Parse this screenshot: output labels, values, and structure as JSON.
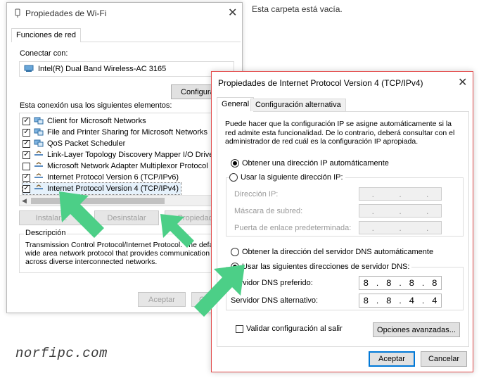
{
  "background": {
    "empty_folder_text": "Esta carpeta está vacía."
  },
  "wifi_dialog": {
    "title": "Propiedades de Wi-Fi",
    "tab": "Funciones de red",
    "connect_using_label": "Conectar con:",
    "adapter": "Intel(R) Dual Band Wireless-AC 3165",
    "configure_button": "Configurar...",
    "items_label": "Esta conexión usa los siguientes elementos:",
    "items": [
      {
        "label": "Client for Microsoft Networks",
        "checked": true,
        "icon": "network-client-icon"
      },
      {
        "label": "File and Printer Sharing for Microsoft Networks",
        "checked": true,
        "icon": "file-sharing-icon"
      },
      {
        "label": "QoS Packet Scheduler",
        "checked": true,
        "icon": "scheduler-icon"
      },
      {
        "label": "Link-Layer Topology Discovery Mapper I/O Driver",
        "checked": true,
        "icon": "protocol-icon"
      },
      {
        "label": "Microsoft Network Adapter Multiplexor Protocol",
        "checked": false,
        "icon": "protocol-icon"
      },
      {
        "label": "Internet Protocol Version 6 (TCP/IPv6)",
        "checked": true,
        "icon": "protocol-icon"
      },
      {
        "label": "Internet Protocol Version 4 (TCP/IPv4)",
        "checked": true,
        "icon": "protocol-icon"
      }
    ],
    "install_button": "Instalar...",
    "uninstall_button": "Desinstalar",
    "properties_button": "Propiedades",
    "description_label": "Descripción",
    "description_text": "Transmission Control Protocol/Internet Protocol. The default wide area network protocol that provides communication across diverse interconnected networks.",
    "ok_button": "Aceptar",
    "cancel_button": "Cancelar"
  },
  "ipv4_dialog": {
    "title": "Propiedades de Internet Protocol Version 4 (TCP/IPv4)",
    "tabs": [
      "General",
      "Configuración alternativa"
    ],
    "intro_text": "Puede hacer que la configuración IP se asigne automáticamente si la red admite esta funcionalidad. De lo contrario, deberá consultar con el administrador de red cuál es la configuración IP apropiada.",
    "auto_ip_label": "Obtener una dirección IP automáticamente",
    "manual_ip_label": "Usar la siguiente dirección IP:",
    "ip_address_label": "Dirección IP:",
    "subnet_label": "Máscara de subred:",
    "gateway_label": "Puerta de enlace predeterminada:",
    "auto_dns_label": "Obtener la dirección del servidor DNS automáticamente",
    "manual_dns_label": "Usar las siguientes direcciones de servidor DNS:",
    "preferred_dns_label": "Servidor DNS preferido:",
    "preferred_dns": [
      "8",
      "8",
      "8",
      "8"
    ],
    "alternate_dns_label": "Servidor DNS alternativo:",
    "alternate_dns": [
      "8",
      "8",
      "4",
      "4"
    ],
    "validate_label": "Validar configuración al salir",
    "validate_checked": false,
    "advanced_button": "Opciones avanzadas...",
    "ok_button": "Aceptar",
    "cancel_button": "Cancelar",
    "selected": {
      "ip_mode": "auto",
      "dns_mode": "manual"
    }
  },
  "watermark": "norfipc.com",
  "colors": {
    "accent": "#0078d7",
    "arrow": "#4ccf87",
    "window_border": "#e34b4b"
  }
}
